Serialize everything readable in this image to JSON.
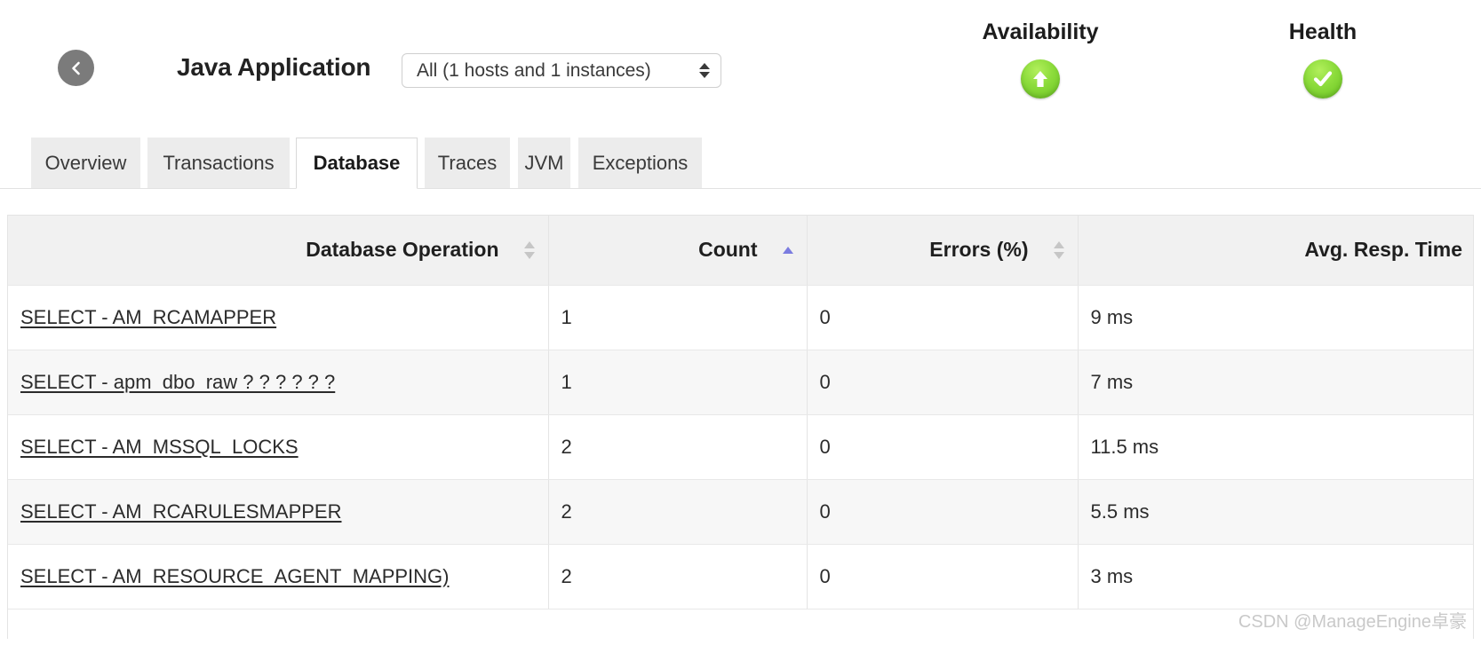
{
  "header": {
    "back_icon": "chevron-left-icon",
    "app_title": "Java Application",
    "instance_selector": {
      "selected": "All (1 hosts and 1 instances)",
      "stepper_icon": "updown-stepper-icon"
    },
    "metrics": [
      {
        "label": "Availability",
        "icon": "green-up-arrow-icon",
        "status_color": "#83d62f"
      },
      {
        "label": "Health",
        "icon": "green-check-icon",
        "status_color": "#83d62f"
      }
    ]
  },
  "tabs": [
    {
      "label": "Overview",
      "active": false
    },
    {
      "label": "Transactions",
      "active": false
    },
    {
      "label": "Database",
      "active": true
    },
    {
      "label": "Traces",
      "active": false
    },
    {
      "label": "JVM",
      "active": false
    },
    {
      "label": "Exceptions",
      "active": false
    }
  ],
  "table": {
    "columns": [
      {
        "label": "Database Operation",
        "sort": "none",
        "sort_icon": "sort-both-icon"
      },
      {
        "label": "Count",
        "sort": "asc",
        "sort_icon": "sort-asc-icon"
      },
      {
        "label": "Errors (%)",
        "sort": "none",
        "sort_icon": "sort-both-icon"
      },
      {
        "label": "Avg. Resp. Time",
        "sort": "none",
        "sort_icon": ""
      }
    ],
    "rows": [
      {
        "operation": "SELECT - AM_RCAMAPPER",
        "count": "1",
        "errors": "0",
        "avg_resp_time": "9 ms"
      },
      {
        "operation": "SELECT - apm_dbo_raw ? ? ? ? ? ?",
        "count": "1",
        "errors": "0",
        "avg_resp_time": "7 ms"
      },
      {
        "operation": "SELECT - AM_MSSQL_LOCKS",
        "count": "2",
        "errors": "0",
        "avg_resp_time": "11.5 ms"
      },
      {
        "operation": "SELECT - AM_RCARULESMAPPER",
        "count": "2",
        "errors": "0",
        "avg_resp_time": "5.5 ms"
      },
      {
        "operation": "SELECT - AM_RESOURCE_AGENT_MAPPING)",
        "count": "2",
        "errors": "0",
        "avg_resp_time": "3 ms"
      }
    ]
  },
  "watermark": "CSDN @ManageEngine卓豪"
}
